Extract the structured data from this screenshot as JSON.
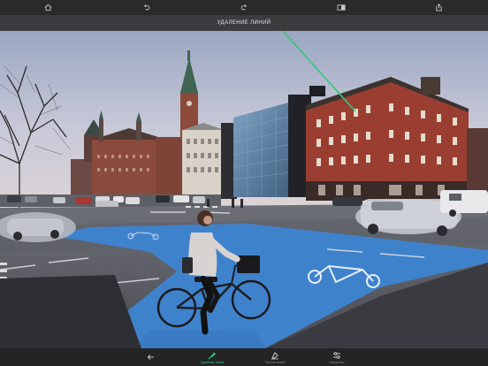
{
  "toolbar": {
    "title": "УДАЛЕНИЕ ЛИНИЙ",
    "icons": [
      "home-icon",
      "undo-icon",
      "redo-icon",
      "compare-icon",
      "share-icon"
    ]
  },
  "bottom_bar": {
    "items": [
      {
        "id": "back",
        "label": "",
        "icon": "back-arrow-icon",
        "active": false
      },
      {
        "id": "lines",
        "label": "Удаление линий",
        "icon": "line-removal-icon",
        "active": true
      },
      {
        "id": "eraser",
        "label": "Ластик линий",
        "icon": "line-eraser-icon",
        "active": false
      },
      {
        "id": "settings",
        "label": "Настройки",
        "icon": "sliders-icon",
        "active": false
      }
    ]
  },
  "colors": {
    "accent": "#34c77b",
    "topbar": "#2a2a2c",
    "titlebar": "#3c3c3e",
    "bottombar": "#242426",
    "bike_lane": "#3f82cc"
  }
}
